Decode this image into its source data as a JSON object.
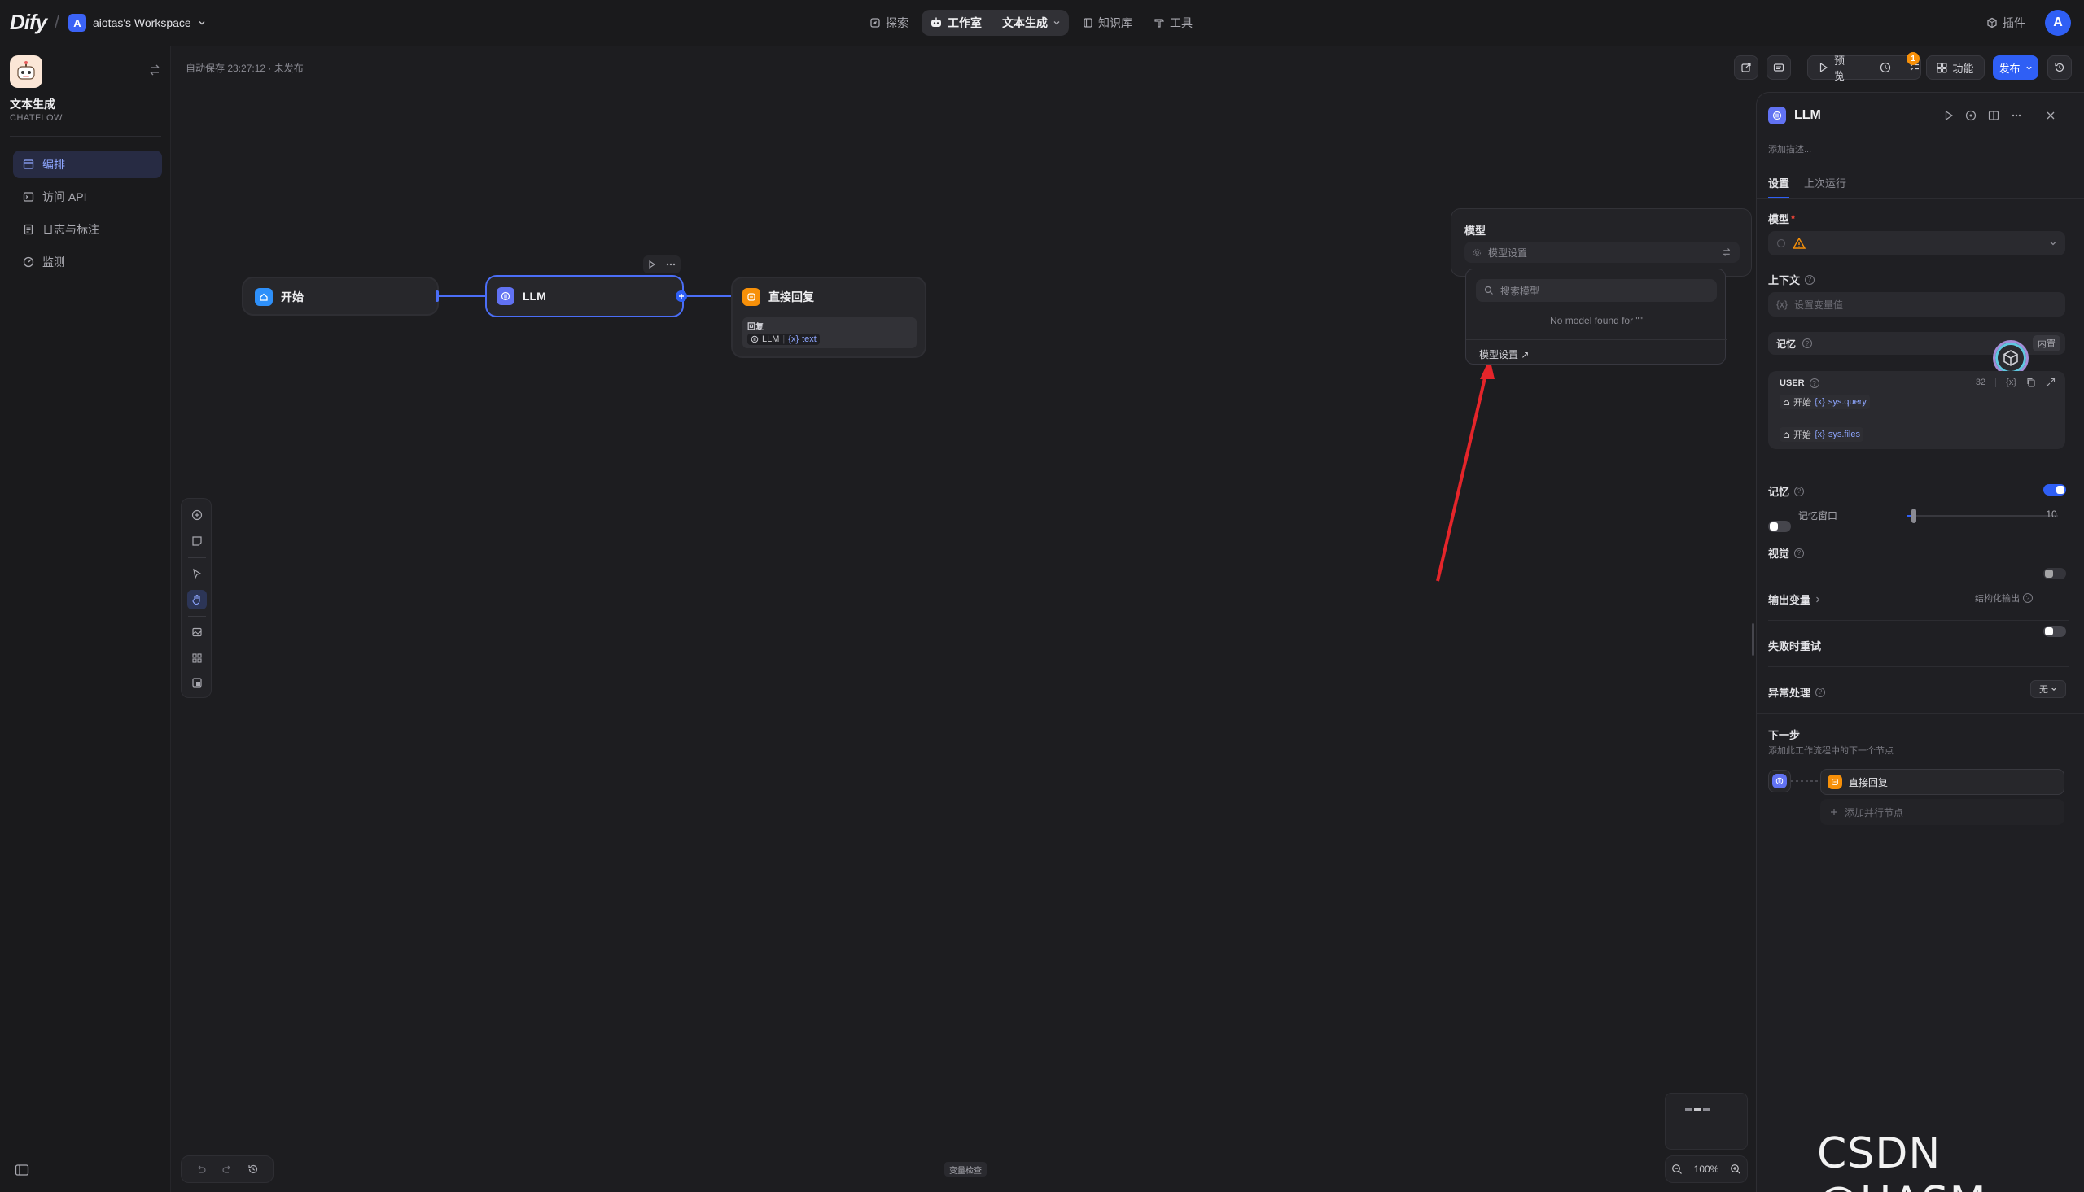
{
  "topbar": {
    "logo": "Dify",
    "workspace_initial": "A",
    "workspace_name": "aiotas's Workspace",
    "nav": {
      "explore": "探索",
      "studio": "工作室",
      "app_switch": "文本生成",
      "knowledge": "知识库",
      "tools": "工具"
    },
    "plugins": "插件",
    "user_initial": "A"
  },
  "sidebar": {
    "app_name": "文本生成",
    "app_type": "CHATFLOW",
    "menu": [
      {
        "label": "编排",
        "icon": "layout-icon",
        "active": true
      },
      {
        "label": "访问 API",
        "icon": "terminal-icon",
        "active": false
      },
      {
        "label": "日志与标注",
        "icon": "file-list-icon",
        "active": false
      },
      {
        "label": "监测",
        "icon": "monitor-icon",
        "active": false
      }
    ]
  },
  "canvas": {
    "autosave": "自动保存 23:27:12 · 未发布",
    "toolbar": {
      "preview": "预览",
      "badge_count": "1",
      "features": "功能",
      "publish": "发布"
    },
    "nodes": {
      "start": {
        "title": "开始"
      },
      "llm": {
        "title": "LLM"
      },
      "answer": {
        "title": "直接回复",
        "field_label": "回复",
        "ref_node": "LLM",
        "ref_var_prefix": "{x}",
        "ref_var": "text"
      }
    },
    "var_check": "变量检查",
    "zoom": "100%"
  },
  "model_popover": {
    "title": "模型",
    "select_placeholder": "模型设置",
    "search_placeholder": "搜索模型",
    "empty": "No model found for \"\"",
    "settings_link": "模型设置 ↗"
  },
  "panel": {
    "title": "LLM",
    "desc_placeholder": "添加描述...",
    "tabs": [
      "设置",
      "上次运行"
    ],
    "model_label": "模型",
    "required_mark": "*",
    "context_label": "上下文",
    "context_placeholder": "设置变量值",
    "memory_label": "记忆",
    "memory_builtin": "内置",
    "user_label": "USER",
    "token_count": "32",
    "user_vars": [
      {
        "node": "开始",
        "var": "sys.query"
      },
      {
        "node": "开始",
        "var": "sys.files"
      }
    ],
    "memory_toggle_label": "记忆",
    "memory_window_label": "记忆窗口",
    "memory_window_value": "10",
    "memory_window_fraction": 0.05,
    "vision_label": "视觉",
    "output_vars_label": "输出变量",
    "structured_output_label": "结构化输出",
    "retry_label": "失败时重试",
    "error_handling_label": "异常处理",
    "error_handling_value": "无",
    "next_step_title": "下一步",
    "next_step_desc": "添加此工作流程中的下一个节点",
    "next_node": "直接回复",
    "add_parallel": "添加并行节点"
  },
  "watermark": "CSDN @UASM",
  "colors": {
    "accent": "#2f5ff5",
    "llm_icon": "#6172f3",
    "answer_icon": "#f79009",
    "start_icon": "#2e90fa",
    "warning": "#f79009",
    "arrow": "#e5252a"
  }
}
